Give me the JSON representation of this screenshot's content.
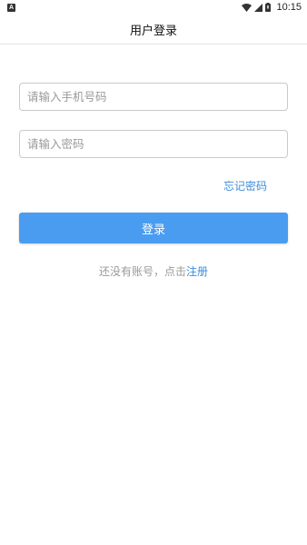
{
  "status_bar": {
    "notification_icon_label": "A",
    "icons": [
      "wifi-icon",
      "cellular-icon",
      "battery-icon"
    ],
    "time": "10:15"
  },
  "header": {
    "title": "用户登录"
  },
  "form": {
    "phone_placeholder": "请输入手机号码",
    "phone_value": "",
    "password_placeholder": "请输入密码",
    "password_value": "",
    "forgot_password_label": "忘记密码",
    "login_label": "登录",
    "register_prompt": "还没有账号，点击",
    "register_link": "注册"
  },
  "colors": {
    "primary": "#4a9cf0",
    "link": "#3d8ddb",
    "hint": "#9a9a9a",
    "border": "#c9c9c9"
  }
}
